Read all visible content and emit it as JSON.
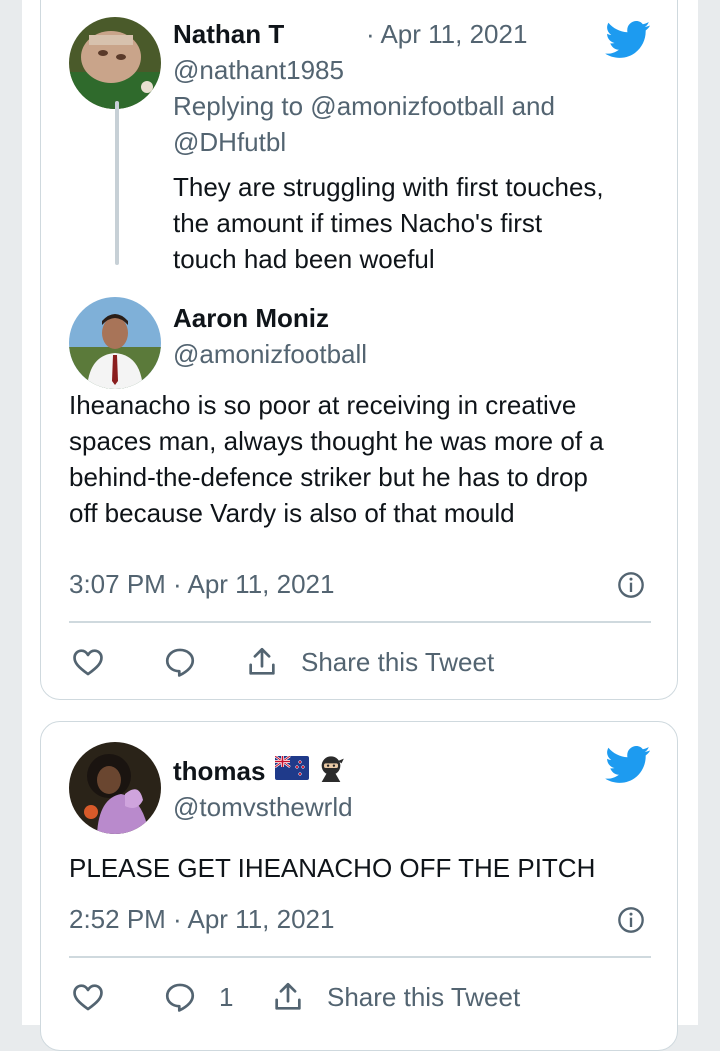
{
  "colors": {
    "twitter_blue": "#1d9bf0",
    "text_primary": "#0f1419",
    "text_secondary": "#536471",
    "border": "#cfd9de"
  },
  "tweet1": {
    "parent": {
      "name": "Nathan T",
      "date": "· Apr 11, 2021",
      "handle": "@nathant1985",
      "replying_line1": "Replying to @amonizfootball and",
      "replying_line2": "@DHfutbl",
      "text_lines": [
        "They are struggling with first touches,",
        "the amount if times Nacho's first",
        "touch had been woeful"
      ]
    },
    "main": {
      "name": "Aaron Moniz",
      "handle": "@amonizfootball",
      "text_lines": [
        "Iheanacho is so poor at receiving in creative",
        "spaces man, always thought he was more of a",
        "behind-the-defence striker but he has to drop",
        "off because Vardy is also of that mould"
      ],
      "timestamp": "3:07 PM · Apr 11, 2021"
    },
    "actions": {
      "like_icon": "heart-icon",
      "reply_icon": "speech-bubble-icon",
      "share_icon": "share-icon",
      "share_label": "Share this Tweet"
    }
  },
  "tweet2": {
    "name": "thomas",
    "name_emojis": [
      "new-zealand-flag",
      "ninja-emoji"
    ],
    "handle": "@tomvsthewrld",
    "text": "PLEASE GET IHEANACHO OFF THE PITCH",
    "timestamp": "2:52 PM · Apr 11, 2021",
    "actions": {
      "like_icon": "heart-icon",
      "reply_icon": "speech-bubble-icon",
      "reply_count": "1",
      "share_icon": "share-icon",
      "share_label": "Share this Tweet"
    }
  }
}
